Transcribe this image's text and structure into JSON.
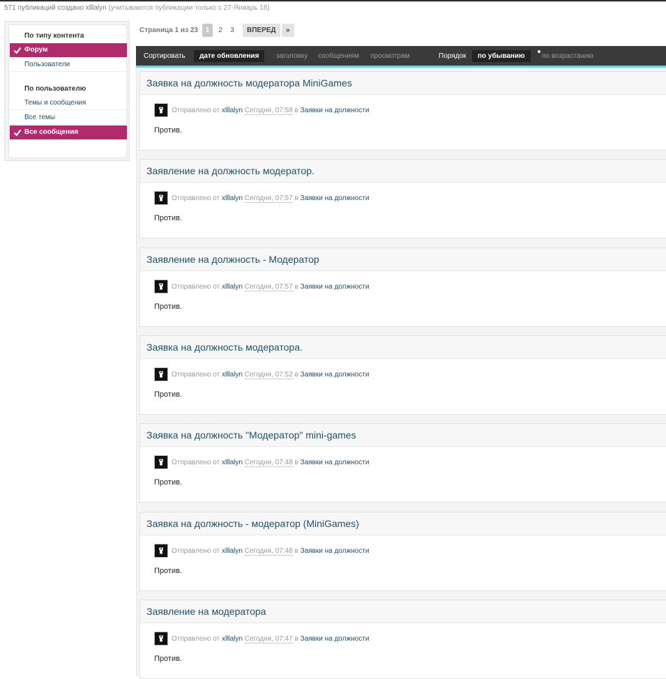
{
  "summary": {
    "main": "571 публикаций создано xlllalyn",
    "since": "(учитываются публикации только с 27-Январь 18)"
  },
  "sidebar": {
    "by_type_heading": "По типу контента",
    "by_type_items": [
      {
        "label": "Форум",
        "active": true
      },
      {
        "label": "Пользователи",
        "active": false
      }
    ],
    "by_user_heading": "По пользователю",
    "by_user_items": [
      {
        "label": "Темы и сообщения",
        "active": false
      },
      {
        "label": "Все темы",
        "active": false
      },
      {
        "label": "Все сообщения",
        "active": true
      }
    ]
  },
  "pager": {
    "label": "Страница 1 из 23",
    "pages": [
      "1",
      "2",
      "3"
    ],
    "current": "1",
    "next_label": "ВПЕРЕД",
    "last_label": "»"
  },
  "sortbar": {
    "sort_label": "Сортировать",
    "sort_options": [
      {
        "label": "дате обновления",
        "active": true
      },
      {
        "label": "заголовку",
        "active": false
      },
      {
        "label": "сообщениям",
        "active": false
      },
      {
        "label": "просмотрам",
        "active": false
      }
    ],
    "order_label": "Порядок",
    "order_options": [
      {
        "label": "по убыванию",
        "active": true
      },
      {
        "label": "по возрастанию",
        "active": false
      }
    ]
  },
  "colors": {
    "accent": "#b12a6b",
    "sortbar_bg": "#3a3a3a",
    "sortbar_line": "#6ecfd6",
    "link": "#1f4e6b"
  },
  "posts": [
    {
      "title": "Заявка на должность модератора MiniGames",
      "prefix": "Отправлено от",
      "author": "xlllalyn",
      "time": "Сегодня, 07:58",
      "in": "в",
      "forum": "Заявки на должности",
      "text": "Против."
    },
    {
      "title": "Заявление на должность модератор.",
      "prefix": "Отправлено от",
      "author": "xlllalyn",
      "time": "Сегодня, 07:57",
      "in": "в",
      "forum": "Заявки на должности",
      "text": "Против."
    },
    {
      "title": "Заявление на должность - Модератор",
      "prefix": "Отправлено от",
      "author": "xlllalyn",
      "time": "Сегодня, 07:57",
      "in": "в",
      "forum": "Заявки на должности",
      "text": "Против."
    },
    {
      "title": "Заявка на должность модератора.",
      "prefix": "Отправлено от",
      "author": "xlllalyn",
      "time": "Сегодня, 07:52",
      "in": "в",
      "forum": "Заявки на должности",
      "text": "Против."
    },
    {
      "title": "Заявка на должность \"Модератор\" mini-games",
      "prefix": "Отправлено от",
      "author": "xlllalyn",
      "time": "Сегодня, 07:48",
      "in": "в",
      "forum": "Заявки на должности",
      "text": "Против."
    },
    {
      "title": "Заявка на должность - модератор (MiniGames)",
      "prefix": "Отправлено от",
      "author": "xlllalyn",
      "time": "Сегодня, 07:48",
      "in": "в",
      "forum": "Заявки на должности",
      "text": "Против."
    },
    {
      "title": "Заявление на модератора",
      "prefix": "Отправлено от",
      "author": "xlllalyn",
      "time": "Сегодня, 07:47",
      "in": "в",
      "forum": "Заявки на должности",
      "text": "Против."
    }
  ]
}
